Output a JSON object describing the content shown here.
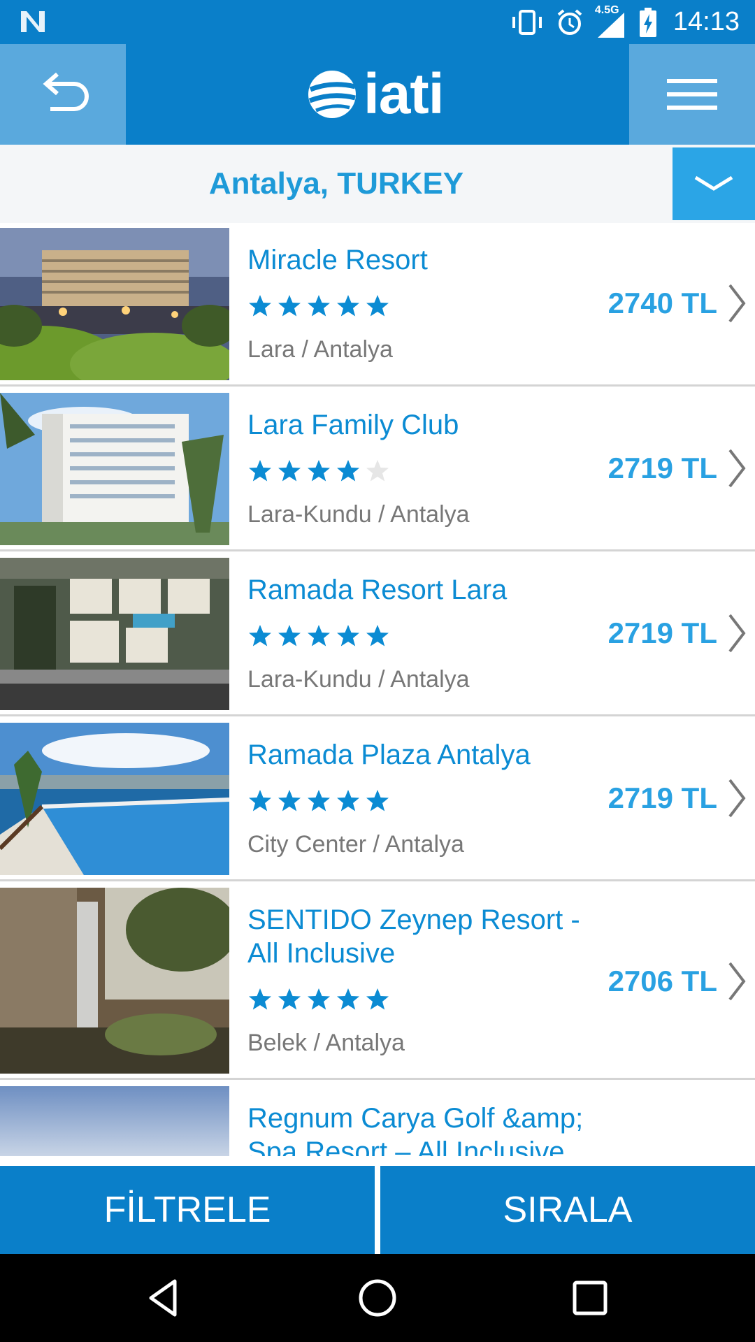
{
  "status_bar": {
    "time": "14:13",
    "network_type": "4.5G",
    "icons": [
      "n-icon",
      "vibrate-icon",
      "alarm-icon",
      "signal-icon",
      "battery-charging-icon"
    ]
  },
  "header": {
    "logo_text": "iati",
    "back_icon": "back-arrow-icon",
    "menu_icon": "hamburger-menu-icon"
  },
  "city_selector": {
    "label": "Antalya, TURKEY",
    "dropdown_icon": "chevron-down-icon"
  },
  "hotels": [
    {
      "name": "Miracle Resort",
      "stars": 5,
      "location": "Lara / Antalya",
      "price": "2740 TL"
    },
    {
      "name": "Lara Family Club",
      "stars": 4,
      "location": "Lara-Kundu / Antalya",
      "price": "2719 TL"
    },
    {
      "name": "Ramada Resort Lara",
      "stars": 5,
      "location": "Lara-Kundu / Antalya",
      "price": "2719 TL"
    },
    {
      "name": "Ramada Plaza Antalya",
      "stars": 5,
      "location": "City Center / Antalya",
      "price": "2719 TL"
    },
    {
      "name": "SENTIDO Zeynep Resort - All Inclusive",
      "stars": 5,
      "location": "Belek / Antalya",
      "price": "2706 TL"
    },
    {
      "name": "Regnum Carya Golf &amp; Spa Resort – All Inclusive"
    }
  ],
  "bottom_bar": {
    "filter_label": "FİLTRELE",
    "sort_label": "SIRALA"
  },
  "colors": {
    "brand_blue": "#0a7fc9",
    "light_blue": "#5aa9dd",
    "accent_blue": "#29a1e2",
    "star_filled": "#0b8bd3",
    "star_empty": "#e6e6e6"
  }
}
